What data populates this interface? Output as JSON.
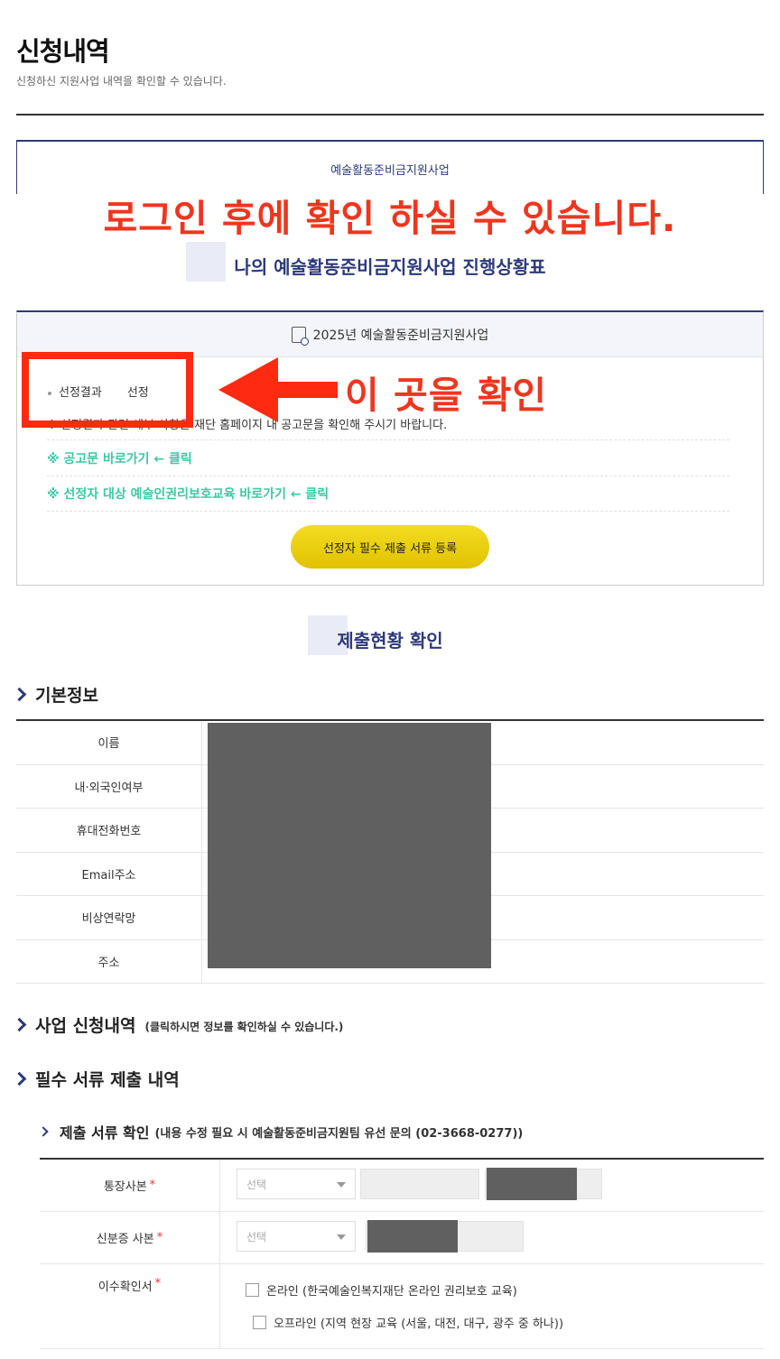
{
  "header": {
    "title": "신청내역",
    "subtitle": "신청하신 지원사업 내역을 확인할 수 있습니다."
  },
  "program": {
    "label": "예술활동준비금지원사업",
    "progress_title": "나의 예술활동준비금지원사업 진행상황표"
  },
  "overlay": {
    "login_notice": "로그인 후에 확인 하실 수 있습니다.",
    "check_here": "이 곳을 확인"
  },
  "result": {
    "header": "2025년 예술활동준비금지원사업",
    "result_label": "선정결과",
    "result_value": "선정",
    "notice": "※ 선정결과 관련 세부 사항은 재단 홈페이지 내 공고문을 확인해 주시기 바랍니다.",
    "link_notice": "※ 공고문 바로가기 ← 클릭",
    "link_education": "※ 선정자 대상 예술인권리보호교육 바로가기 ← 클릭",
    "submit_button": "선정자 필수 제출 서류 등록"
  },
  "submission": {
    "title": "제출현황 확인"
  },
  "basic_info": {
    "title": "기본정보",
    "rows": [
      "이름",
      "내·외국인여부",
      "휴대전화번호",
      "Email주소",
      "비상연락망",
      "주소"
    ]
  },
  "application": {
    "title": "사업 신청내역",
    "hint": "(클릭하시면 정보를 확인하실 수 있습니다.)"
  },
  "required_docs": {
    "title": "필수 서류 제출 내역",
    "sub_title": "제출 서류 확인",
    "sub_hint": "(내용 수정 필요 시 예술활동준비금지원팀 유선 문의 (02-3668-0277))",
    "rows": [
      {
        "label": "통장사본",
        "required": "*",
        "select": "선택"
      },
      {
        "label": "신분증 사본",
        "required": "*",
        "select": "선택"
      },
      {
        "label": "이수확인서",
        "required": "*"
      }
    ],
    "options": {
      "online": "온라인 (한국예술인복지재단 온라인 권리보호 교육)",
      "offline": "오프라인 (지역 현장 교육 (서울, 대전, 대구, 광주 중 하나))"
    }
  },
  "colors": {
    "brand_navy": "#2d3a7a",
    "annotation_red": "#f0351e",
    "link_green": "#3cc8a4",
    "button_yellow": "#f3dc22"
  }
}
